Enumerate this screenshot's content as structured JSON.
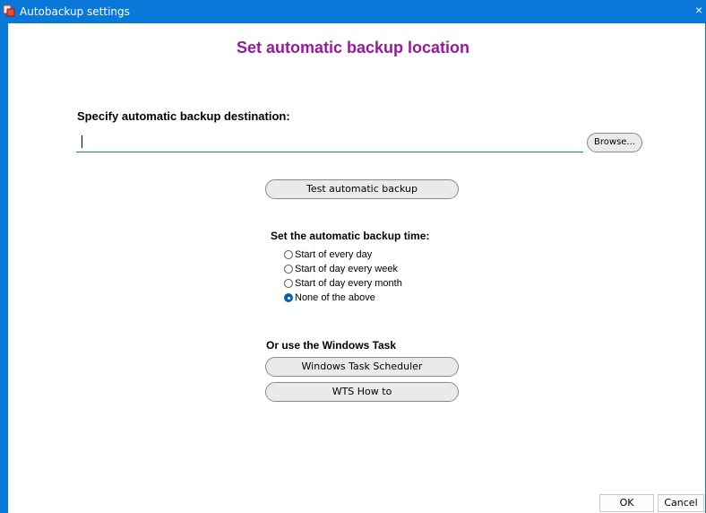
{
  "window": {
    "title": "Autobackup settings",
    "close_glyph": "×",
    "icon": "app-icon"
  },
  "heading": "Set automatic backup location",
  "destination": {
    "label": "Specify automatic backup destination:",
    "value": "",
    "browse_label": "Browse..."
  },
  "test_button_label": "Test automatic backup",
  "schedule": {
    "label": "Set the automatic backup time:",
    "options": [
      {
        "label": "Start of every day",
        "checked": false
      },
      {
        "label": "Start of day every week",
        "checked": false
      },
      {
        "label": "Start of day every month",
        "checked": false
      },
      {
        "label": "None of the above",
        "checked": true
      }
    ]
  },
  "windows_task": {
    "label": "Or use the Windows Task",
    "scheduler_button": "Windows Task Scheduler",
    "howto_button": "WTS How to"
  },
  "footer": {
    "ok_label": "OK",
    "cancel_label": "Cancel"
  },
  "colors": {
    "titlebar": "#0a78d8",
    "heading": "#9a189f",
    "accent": "#0a5fb5"
  }
}
